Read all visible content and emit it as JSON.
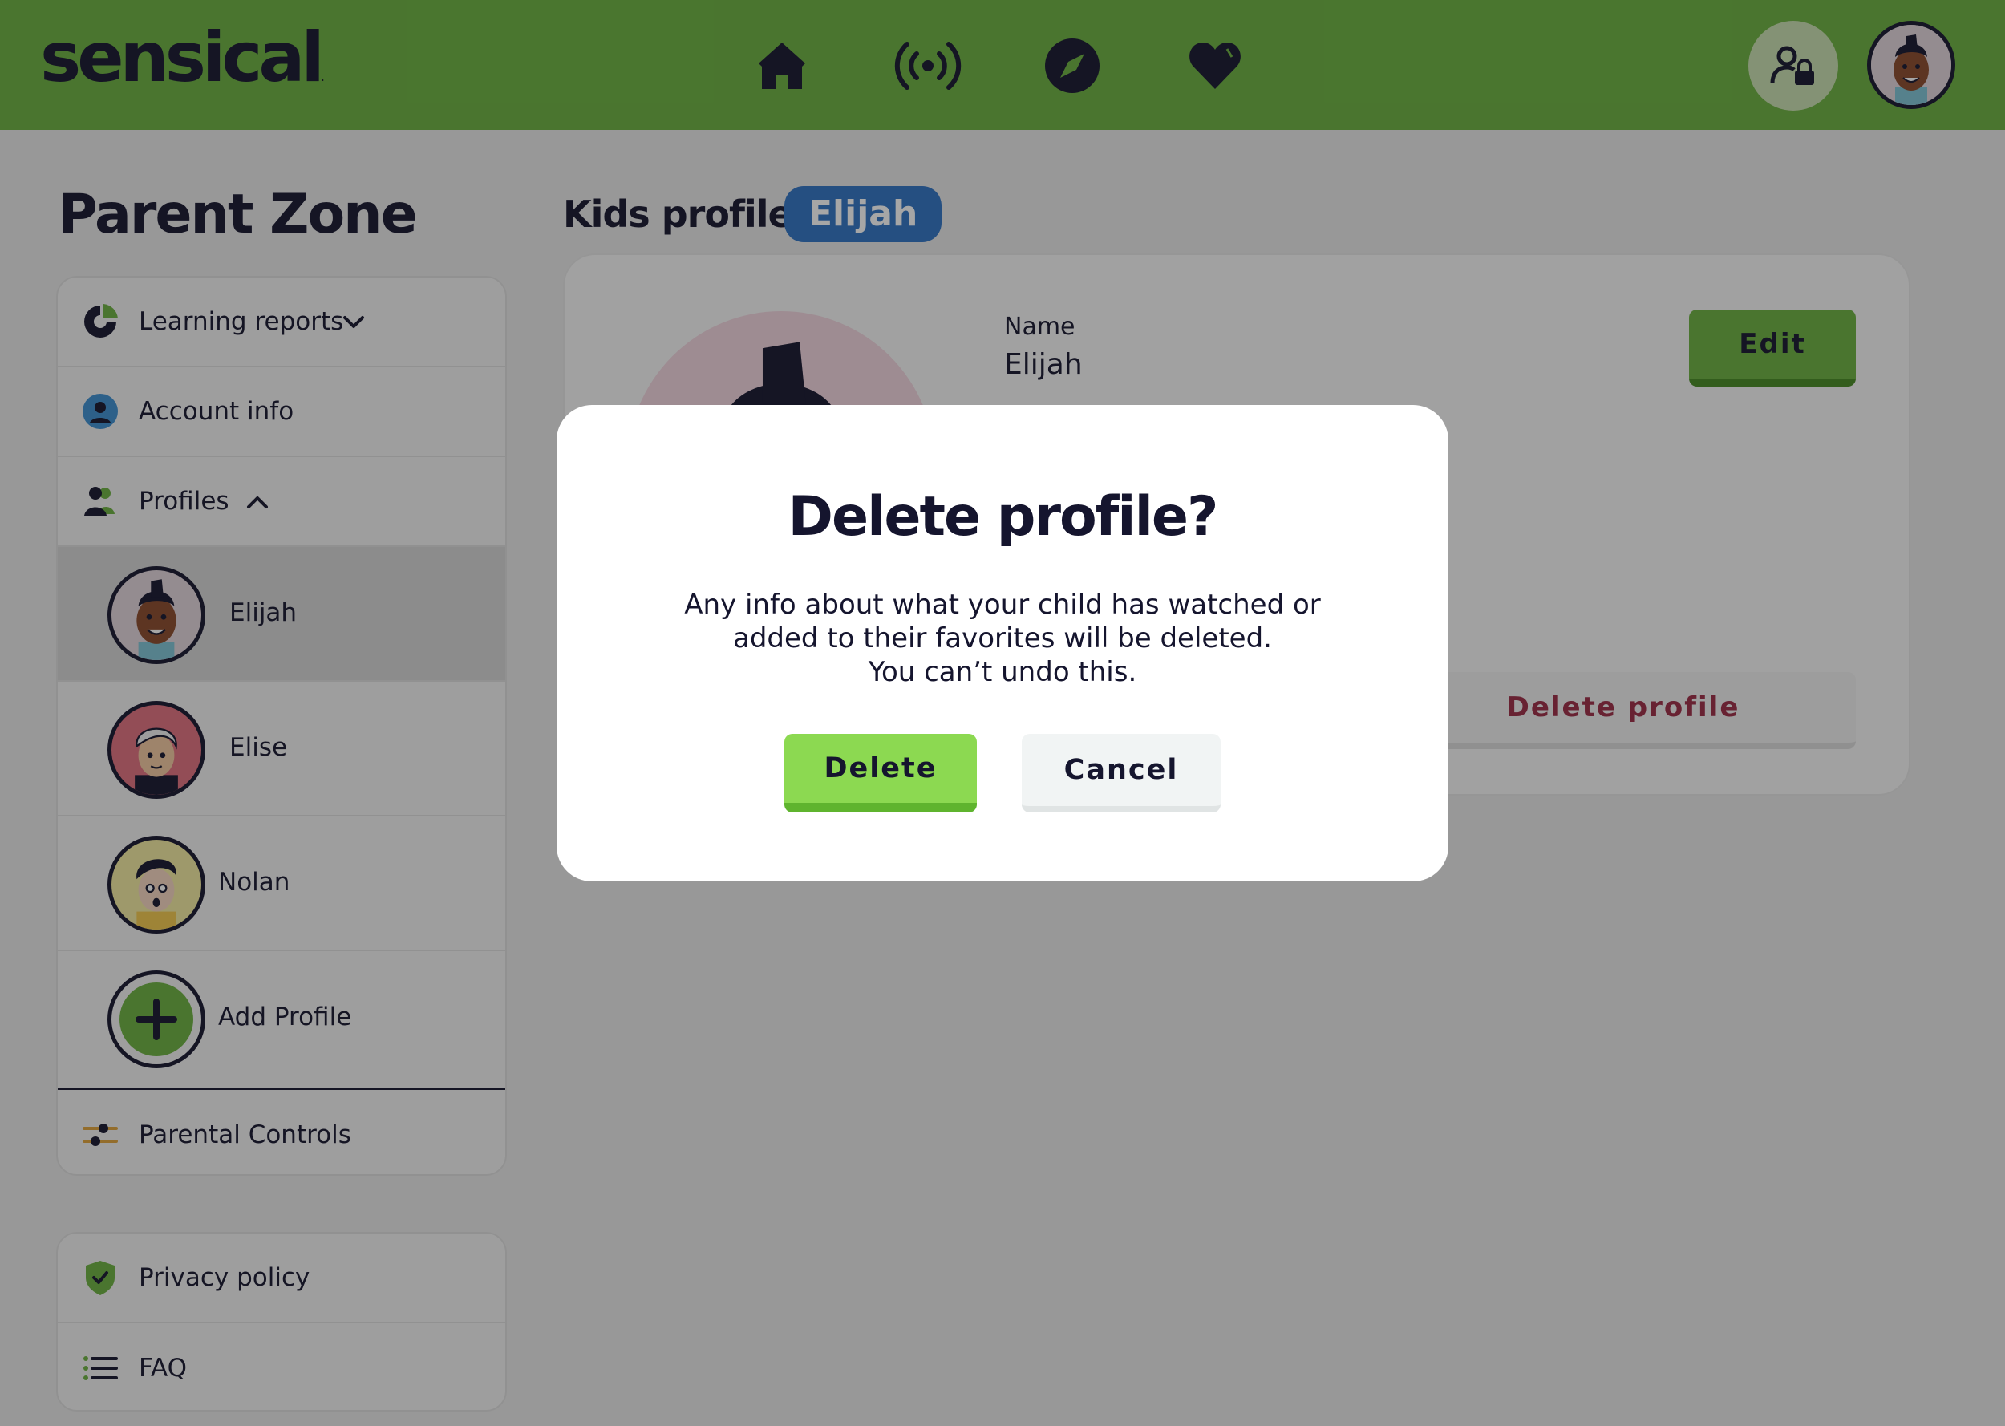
{
  "app": {
    "logo": "sensical",
    "logo_mark": "."
  },
  "topnav": {
    "items": [
      {
        "name": "home",
        "icon": "home-icon"
      },
      {
        "name": "live",
        "icon": "broadcast-icon"
      },
      {
        "name": "explore",
        "icon": "compass-icon"
      },
      {
        "name": "favorites",
        "icon": "heart-icon"
      }
    ],
    "parent_zone_icon": "parent-lock-icon",
    "avatar": "elijah-avatar"
  },
  "sidebar": {
    "title": "Parent Zone",
    "items": [
      {
        "label": "Learning reports",
        "icon": "pie-chart-icon",
        "expanded": false
      },
      {
        "label": "Account info",
        "icon": "person-circle-icon"
      },
      {
        "label": "Profiles",
        "icon": "people-icon",
        "expanded": true
      }
    ],
    "profiles": [
      {
        "label": "Elijah",
        "selected": true
      },
      {
        "label": "Elise",
        "selected": false
      },
      {
        "label": "Nolan",
        "selected": false
      },
      {
        "label": "Add Profile",
        "icon": "plus-icon"
      }
    ],
    "parental_controls": {
      "label": "Parental Controls",
      "icon": "sliders-icon"
    },
    "bottom_items": [
      {
        "label": "Privacy policy",
        "icon": "shield-check-icon"
      },
      {
        "label": "FAQ",
        "icon": "list-icon"
      }
    ]
  },
  "main": {
    "kids_profile_label": "Kids profile:",
    "kids_profile_name": "Elijah",
    "card": {
      "name_label": "Name",
      "name_value": "Elijah",
      "edit_label": "Edit",
      "delete_profile_label": "Delete profile"
    }
  },
  "modal": {
    "title": "Delete profile?",
    "body_lines": [
      "Any info about what your child has watched or",
      "added to their favorites will be deleted.",
      "You can’t undo this."
    ],
    "delete_label": "Delete",
    "cancel_label": "Cancel"
  },
  "colors": {
    "brand_green": "#6bb13f",
    "accent_blue": "#2f73c4",
    "danger_text": "#9b2a45",
    "ink": "#15152e"
  }
}
